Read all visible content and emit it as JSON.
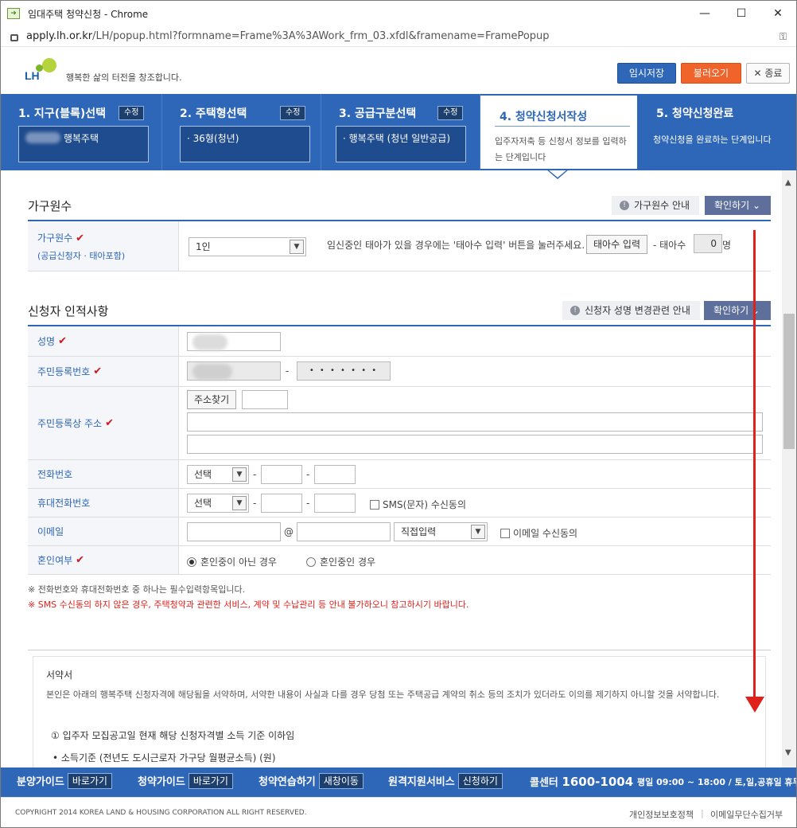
{
  "window": {
    "title": "임대주택 청약신청 - Chrome",
    "min": "—",
    "max": "☐",
    "close": "✕"
  },
  "address": {
    "host": "apply.lh.or.kr",
    "path": "/LH/popup.html?formname=Frame%3A%3AWork_frm_03.xfdl&framename=FramePopup"
  },
  "header": {
    "logo": "LH",
    "slogan": "행복한 삶의 터전을 창조합니다.",
    "save": "임시저장",
    "load": "불러오기",
    "close": "✕ 종료"
  },
  "steps": [
    {
      "title": "1. 지구(블록)선택",
      "edit": "수정",
      "value": "행복주택"
    },
    {
      "title": "2. 주택형선택",
      "edit": "수정",
      "value": "36형(청년)"
    },
    {
      "title": "3. 공급구분선택",
      "edit": "수정",
      "value": "행복주택 (청년 일반공급)"
    },
    {
      "title": "4. 청약신청서작성",
      "desc": "입주자저축 등 신청서 정보를 입력하는 단계입니다"
    },
    {
      "title": "5. 청약신청완료",
      "desc": "청약신청을 완료하는 단계입니다"
    }
  ],
  "household": {
    "title": "가구원수",
    "guide": "가구원수 안내",
    "confirm": "확인하기",
    "label1": "가구원수",
    "label2": "(공급신청자 · 태아포함)",
    "select": "1인",
    "hint": "임신중인 태아가 있을 경우에는 '태아수 입력' 버튼을 눌러주세요.",
    "fetus_btn": "태아수 입력",
    "fetus_label": "- 태아수",
    "fetus_value": "0",
    "fetus_unit": "명"
  },
  "applicant": {
    "title": "신청자 인적사항",
    "guide": "신청자 성명 변경관련 안내",
    "confirm": "확인하기",
    "name_label": "성명",
    "rrn_label": "주민등록번호",
    "rrn_dash": "-",
    "rrn_back": "• • • • • • •",
    "addr_label": "주민등록상 주소",
    "addr_btn": "주소찾기",
    "phone_label": "전화번호",
    "phone_select": "선택",
    "mobile_label": "휴대전화번호",
    "mobile_select": "선택",
    "sms": "SMS(문자) 수신동의",
    "email_label": "이메일",
    "email_at": "@",
    "email_select": "직접입력",
    "email_agree": "이메일 수신동의",
    "marry_label": "혼인여부",
    "marry_opt1": "혼인중이 아닌 경우",
    "marry_opt2": "혼인중인 경우",
    "dash": "-"
  },
  "notes": {
    "n1": "※ 전화번호와 휴대전화번호 중 하나는 필수입력항목입니다.",
    "n2": "※ SMS 수신동의 하지 않은 경우, 주택청약과 관련한 서비스, 계약 및 수납관리 등 안내 불가하오니 참고하시기 바랍니다."
  },
  "pledge": {
    "title": "서약서",
    "body": "본인은 아래의 행복주택 신청자격에 해당됨을 서약하며, 서약한 내용이 사실과 다를 경우 당첨 또는 주택공급 계약의 취소 등의 조치가 있더라도 이의를 제기하지 아니할 것을 서약합니다.",
    "item1": "① 입주자 모집공고일 현재 해당 신청자격별 소득 기준 이하임",
    "item2": "• 소득기준 (전년도 도시근로자 가구당 월평균소득) (원)"
  },
  "footer": {
    "g1": "분양가이드",
    "g1b": "바로가기",
    "g2": "청약가이드",
    "g2b": "바로가기",
    "g3": "청약연습하기",
    "g3b": "새창이동",
    "g4": "원격지원서비스",
    "g4b": "신청하기",
    "call": "콜센터",
    "phone": "1600-1004",
    "hours": "평일 09:00 ~ 18:00 / 토,일,공휴일 휴무"
  },
  "copyright": {
    "text": "COPYRIGHT 2014 KOREA LAND & HOUSING CORPORATION ALL RIGHT RESERVED.",
    "privacy": "개인정보보호정책",
    "email_policy": "이메일무단수집거부"
  },
  "colors": {
    "brand_blue": "#2e66b8",
    "accent_orange": "#f0642b",
    "check_red": "#d0161d",
    "annotation_red": "#e0201a"
  }
}
